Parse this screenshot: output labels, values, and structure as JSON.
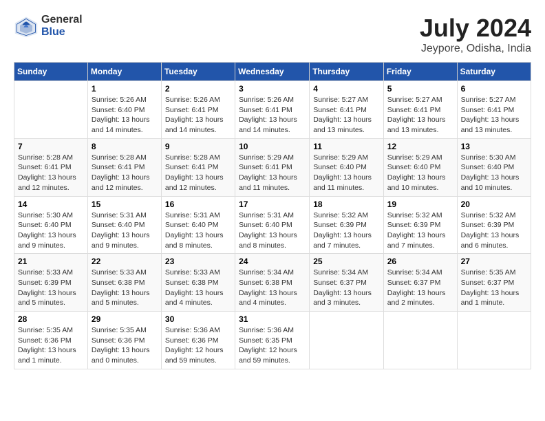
{
  "header": {
    "logo_general": "General",
    "logo_blue": "Blue",
    "month_title": "July 2024",
    "location": "Jeypore, Odisha, India"
  },
  "calendar": {
    "days_of_week": [
      "Sunday",
      "Monday",
      "Tuesday",
      "Wednesday",
      "Thursday",
      "Friday",
      "Saturday"
    ],
    "weeks": [
      [
        {
          "day": "",
          "info": ""
        },
        {
          "day": "1",
          "info": "Sunrise: 5:26 AM\nSunset: 6:40 PM\nDaylight: 13 hours\nand 14 minutes."
        },
        {
          "day": "2",
          "info": "Sunrise: 5:26 AM\nSunset: 6:41 PM\nDaylight: 13 hours\nand 14 minutes."
        },
        {
          "day": "3",
          "info": "Sunrise: 5:26 AM\nSunset: 6:41 PM\nDaylight: 13 hours\nand 14 minutes."
        },
        {
          "day": "4",
          "info": "Sunrise: 5:27 AM\nSunset: 6:41 PM\nDaylight: 13 hours\nand 13 minutes."
        },
        {
          "day": "5",
          "info": "Sunrise: 5:27 AM\nSunset: 6:41 PM\nDaylight: 13 hours\nand 13 minutes."
        },
        {
          "day": "6",
          "info": "Sunrise: 5:27 AM\nSunset: 6:41 PM\nDaylight: 13 hours\nand 13 minutes."
        }
      ],
      [
        {
          "day": "7",
          "info": "Sunrise: 5:28 AM\nSunset: 6:41 PM\nDaylight: 13 hours\nand 12 minutes."
        },
        {
          "day": "8",
          "info": "Sunrise: 5:28 AM\nSunset: 6:41 PM\nDaylight: 13 hours\nand 12 minutes."
        },
        {
          "day": "9",
          "info": "Sunrise: 5:28 AM\nSunset: 6:41 PM\nDaylight: 13 hours\nand 12 minutes."
        },
        {
          "day": "10",
          "info": "Sunrise: 5:29 AM\nSunset: 6:41 PM\nDaylight: 13 hours\nand 11 minutes."
        },
        {
          "day": "11",
          "info": "Sunrise: 5:29 AM\nSunset: 6:40 PM\nDaylight: 13 hours\nand 11 minutes."
        },
        {
          "day": "12",
          "info": "Sunrise: 5:29 AM\nSunset: 6:40 PM\nDaylight: 13 hours\nand 10 minutes."
        },
        {
          "day": "13",
          "info": "Sunrise: 5:30 AM\nSunset: 6:40 PM\nDaylight: 13 hours\nand 10 minutes."
        }
      ],
      [
        {
          "day": "14",
          "info": "Sunrise: 5:30 AM\nSunset: 6:40 PM\nDaylight: 13 hours\nand 9 minutes."
        },
        {
          "day": "15",
          "info": "Sunrise: 5:31 AM\nSunset: 6:40 PM\nDaylight: 13 hours\nand 9 minutes."
        },
        {
          "day": "16",
          "info": "Sunrise: 5:31 AM\nSunset: 6:40 PM\nDaylight: 13 hours\nand 8 minutes."
        },
        {
          "day": "17",
          "info": "Sunrise: 5:31 AM\nSunset: 6:40 PM\nDaylight: 13 hours\nand 8 minutes."
        },
        {
          "day": "18",
          "info": "Sunrise: 5:32 AM\nSunset: 6:39 PM\nDaylight: 13 hours\nand 7 minutes."
        },
        {
          "day": "19",
          "info": "Sunrise: 5:32 AM\nSunset: 6:39 PM\nDaylight: 13 hours\nand 7 minutes."
        },
        {
          "day": "20",
          "info": "Sunrise: 5:32 AM\nSunset: 6:39 PM\nDaylight: 13 hours\nand 6 minutes."
        }
      ],
      [
        {
          "day": "21",
          "info": "Sunrise: 5:33 AM\nSunset: 6:39 PM\nDaylight: 13 hours\nand 5 minutes."
        },
        {
          "day": "22",
          "info": "Sunrise: 5:33 AM\nSunset: 6:38 PM\nDaylight: 13 hours\nand 5 minutes."
        },
        {
          "day": "23",
          "info": "Sunrise: 5:33 AM\nSunset: 6:38 PM\nDaylight: 13 hours\nand 4 minutes."
        },
        {
          "day": "24",
          "info": "Sunrise: 5:34 AM\nSunset: 6:38 PM\nDaylight: 13 hours\nand 4 minutes."
        },
        {
          "day": "25",
          "info": "Sunrise: 5:34 AM\nSunset: 6:37 PM\nDaylight: 13 hours\nand 3 minutes."
        },
        {
          "day": "26",
          "info": "Sunrise: 5:34 AM\nSunset: 6:37 PM\nDaylight: 13 hours\nand 2 minutes."
        },
        {
          "day": "27",
          "info": "Sunrise: 5:35 AM\nSunset: 6:37 PM\nDaylight: 13 hours\nand 1 minute."
        }
      ],
      [
        {
          "day": "28",
          "info": "Sunrise: 5:35 AM\nSunset: 6:36 PM\nDaylight: 13 hours\nand 1 minute."
        },
        {
          "day": "29",
          "info": "Sunrise: 5:35 AM\nSunset: 6:36 PM\nDaylight: 13 hours\nand 0 minutes."
        },
        {
          "day": "30",
          "info": "Sunrise: 5:36 AM\nSunset: 6:36 PM\nDaylight: 12 hours\nand 59 minutes."
        },
        {
          "day": "31",
          "info": "Sunrise: 5:36 AM\nSunset: 6:35 PM\nDaylight: 12 hours\nand 59 minutes."
        },
        {
          "day": "",
          "info": ""
        },
        {
          "day": "",
          "info": ""
        },
        {
          "day": "",
          "info": ""
        }
      ]
    ]
  }
}
